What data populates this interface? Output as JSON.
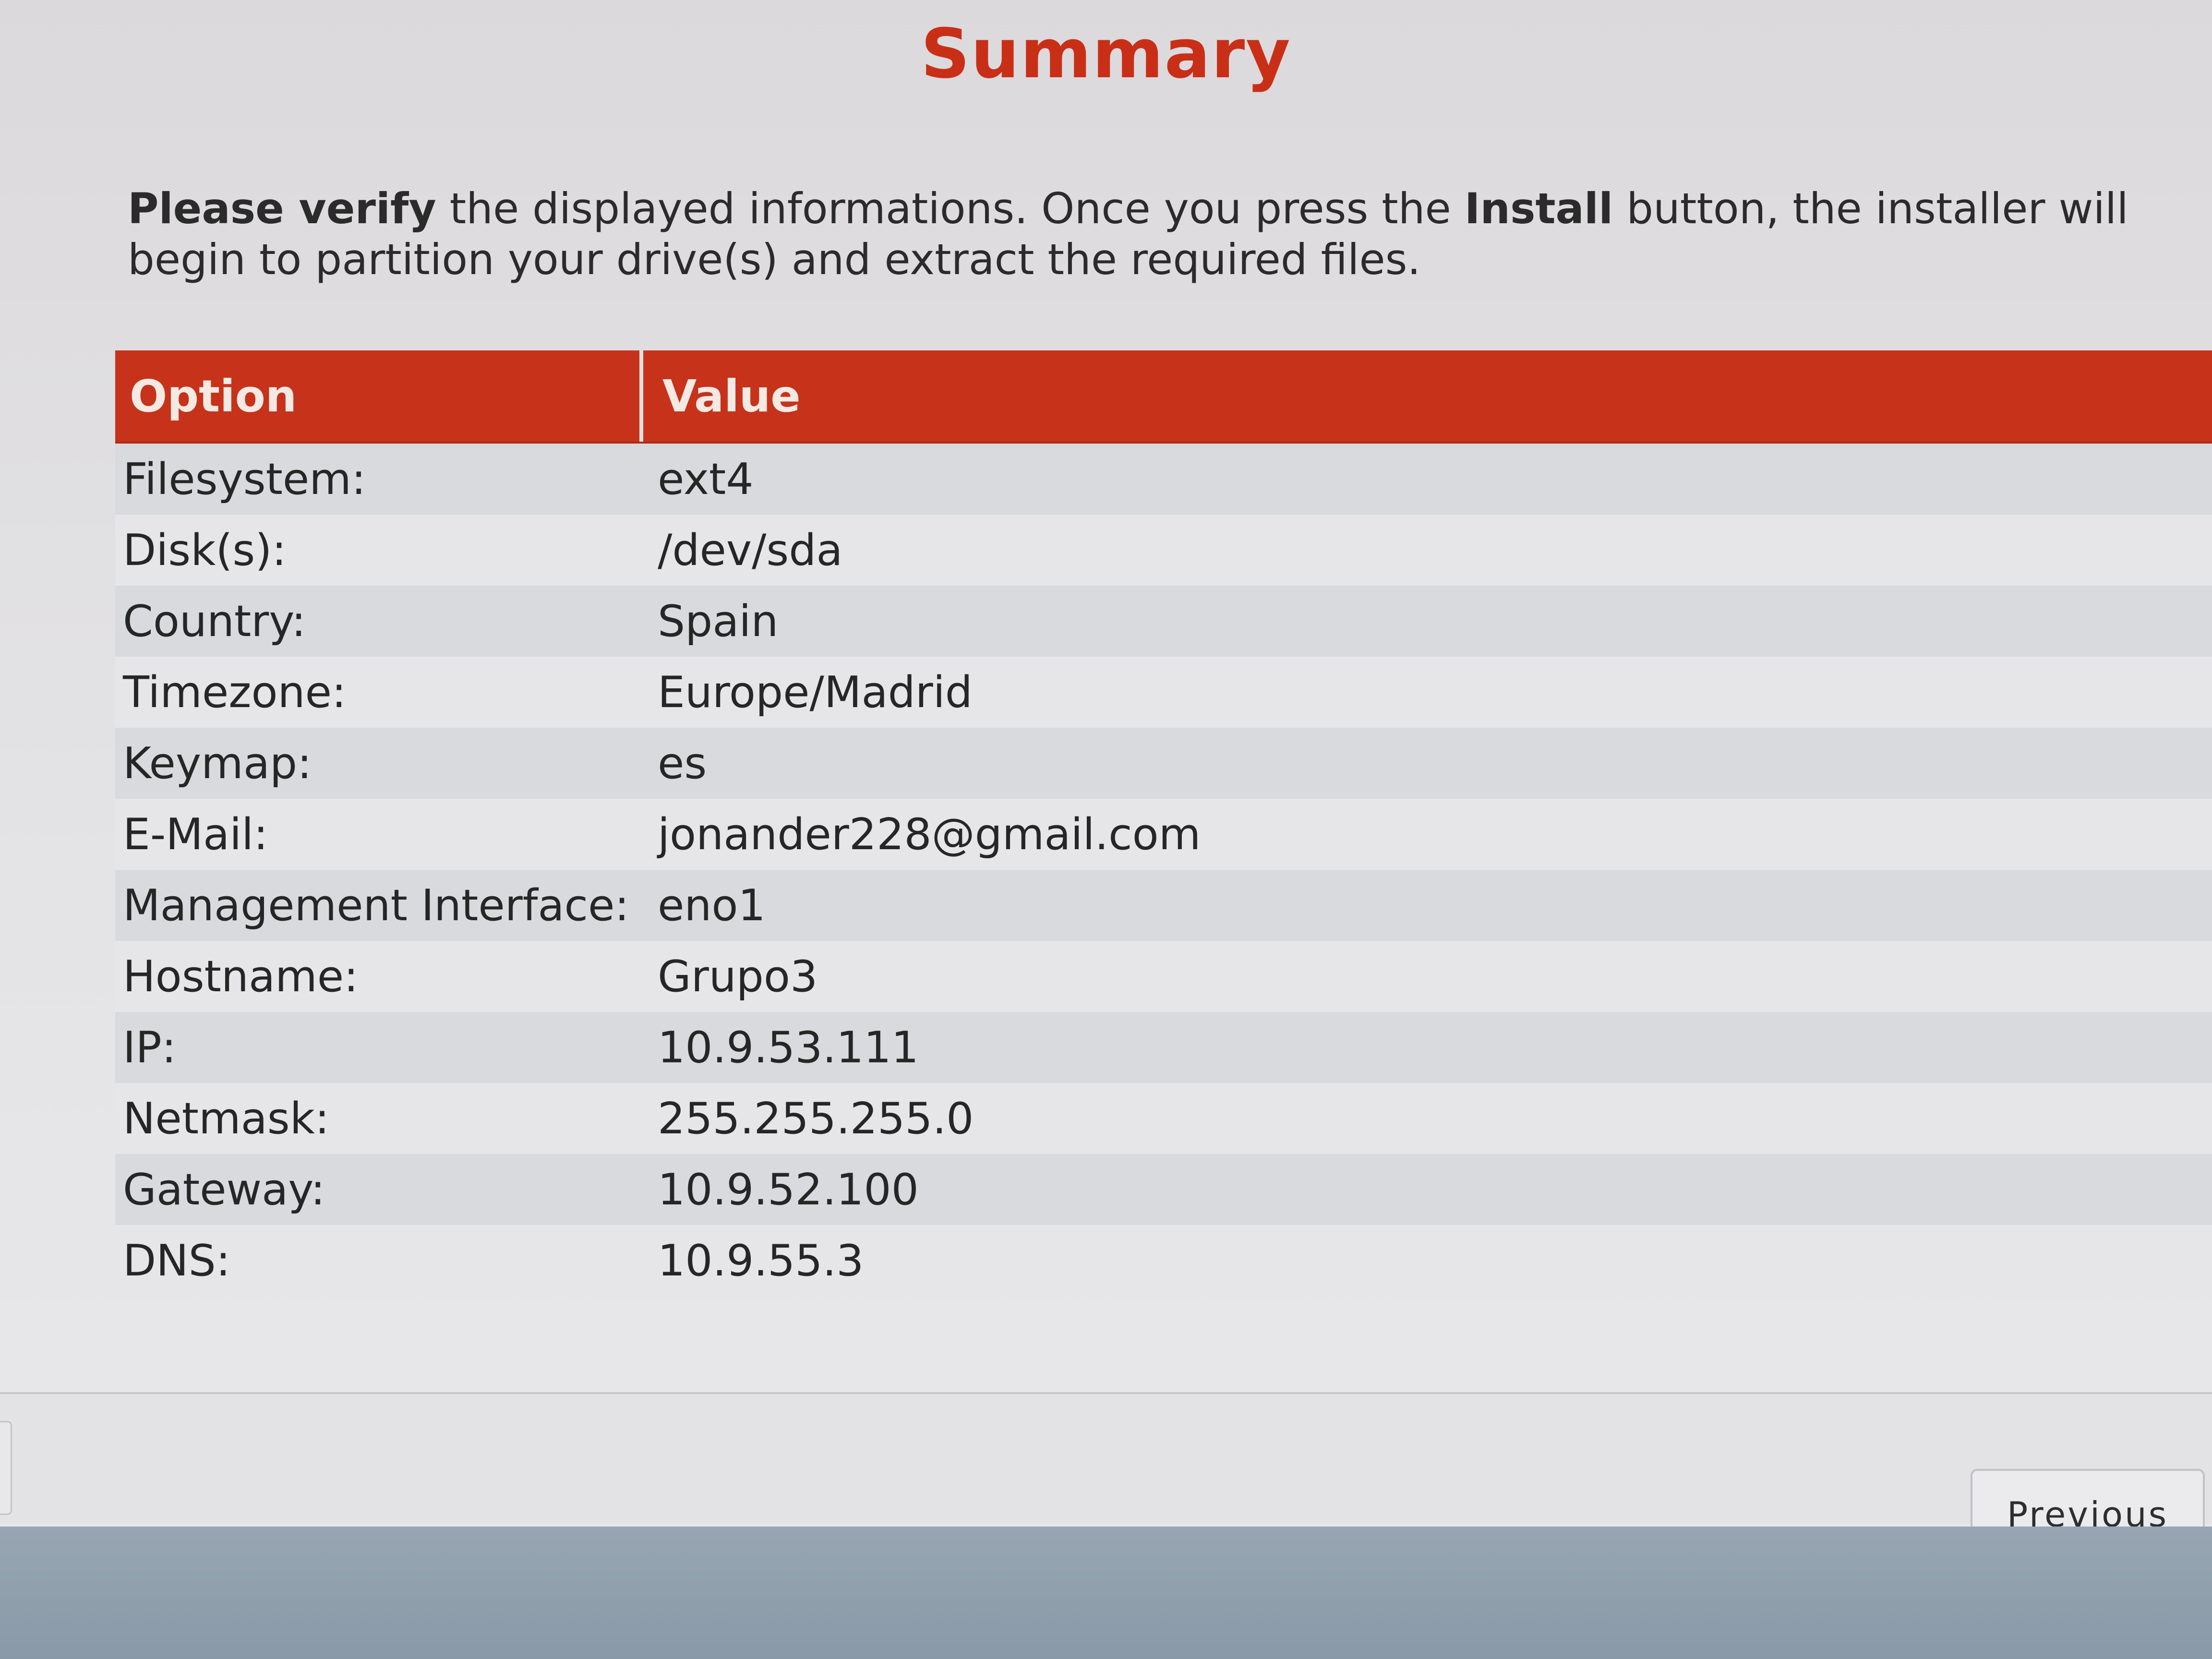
{
  "page": {
    "title": "Summary",
    "intro": {
      "bold1": "Please verify",
      "text1": " the displayed informations. Once you press the ",
      "bold2": "Install",
      "text2": " button, the installer will begin to partition your drive(s) and extract the required files."
    }
  },
  "table": {
    "headers": {
      "option": "Option",
      "value": "Value"
    },
    "rows": [
      {
        "option": "Filesystem:",
        "value": "ext4"
      },
      {
        "option": "Disk(s):",
        "value": "/dev/sda"
      },
      {
        "option": "Country:",
        "value": "Spain"
      },
      {
        "option": "Timezone:",
        "value": "Europe/Madrid"
      },
      {
        "option": "Keymap:",
        "value": "es"
      },
      {
        "option": "E-Mail:",
        "value": "jonander228@gmail.com"
      },
      {
        "option": "Management Interface:",
        "value": "eno1"
      },
      {
        "option": "Hostname:",
        "value": "Grupo3"
      },
      {
        "option": "IP:",
        "value": "10.9.53.111"
      },
      {
        "option": "Netmask:",
        "value": "255.255.255.0"
      },
      {
        "option": "Gateway:",
        "value": "10.9.52.100"
      },
      {
        "option": "DNS:",
        "value": "10.9.55.3"
      }
    ]
  },
  "footer": {
    "previous_label": "Previous"
  },
  "colors": {
    "accent": "#c7321a",
    "title": "#c92f17"
  }
}
